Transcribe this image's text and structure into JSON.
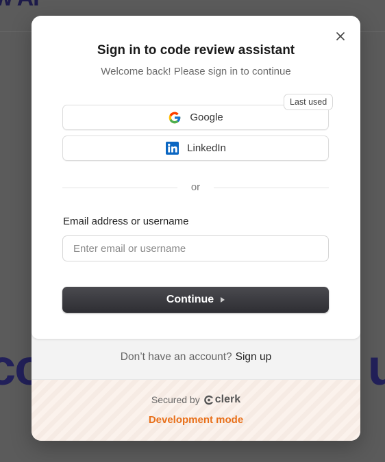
{
  "background": {
    "logo_fragment": "w AI",
    "hero_left": "co",
    "hero_right": "u"
  },
  "modal": {
    "title": "Sign in to code review assistant",
    "subtitle": "Welcome back! Please sign in to continue",
    "close_icon": "close-icon",
    "social": [
      {
        "label": "Google",
        "icon": "google-icon"
      },
      {
        "label": "LinkedIn",
        "icon": "linkedin-icon"
      }
    ],
    "last_used_badge": "Last used",
    "divider_text": "or",
    "email": {
      "label": "Email address or username",
      "placeholder": "Enter email or username",
      "value": ""
    },
    "continue_label": "Continue",
    "signup": {
      "prompt": "Don’t have an account?",
      "link": "Sign up"
    },
    "footer": {
      "secured_by": "Secured by",
      "brand": "clerk",
      "dev_mode": "Development mode"
    }
  },
  "colors": {
    "overlay": "#5b5b5b",
    "primary_button": "#2e2e33",
    "dev_mode": "#e8701a",
    "linkedin": "#0a66c2"
  }
}
